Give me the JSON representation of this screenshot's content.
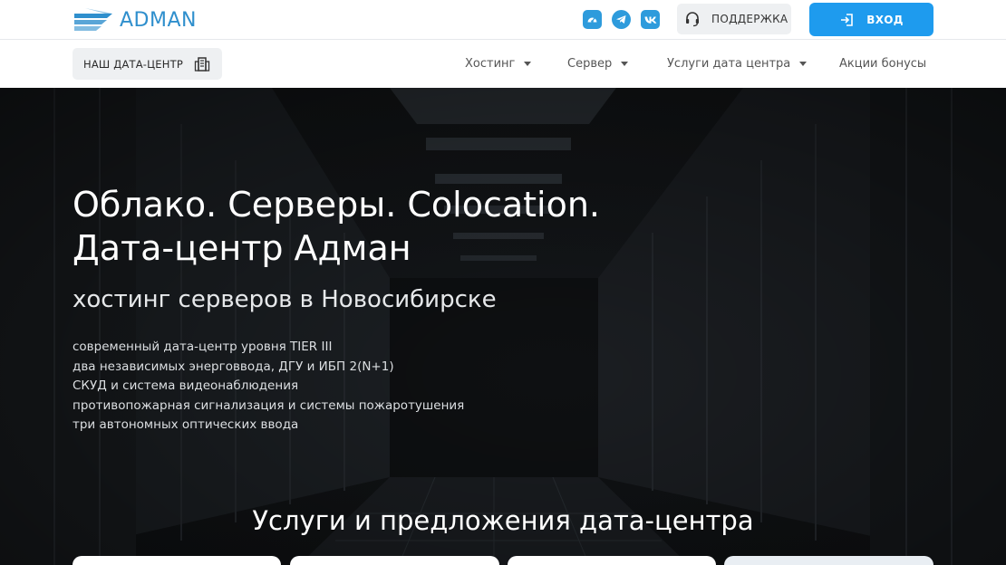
{
  "header": {
    "logo_text": "ADMAN",
    "support_label": "ПОДДЕРЖКА",
    "login_label": "ВХОД",
    "social_icons": [
      "dashboard-icon",
      "telegram-icon",
      "vk-icon"
    ],
    "accent_color": "#1e9bee"
  },
  "nav": {
    "datacenter_label": "НАШ ДАТА-ЦЕНТР",
    "menu": [
      {
        "label": "Хостинг",
        "dropdown": true
      },
      {
        "label": "Сервер",
        "dropdown": true
      },
      {
        "label": "Услуги дата центра",
        "dropdown": true
      },
      {
        "label": "Акции бонусы",
        "dropdown": false
      }
    ]
  },
  "hero": {
    "title_line1": "Облако. Серверы. Colocation.",
    "title_line2": "Дата-центр Адман",
    "subtitle": "хостинг серверов в Новосибирске",
    "features": [
      "современный дата-центр уровня TIER III",
      "два независимых энерговвода, ДГУ и ИБП 2(N+1)",
      "СКУД и система видеонаблюдения",
      "противопожарная сигнализация и системы пожаротушения",
      "три автономных оптических ввода"
    ],
    "services_heading": "Услуги и предложения дата-центра"
  }
}
